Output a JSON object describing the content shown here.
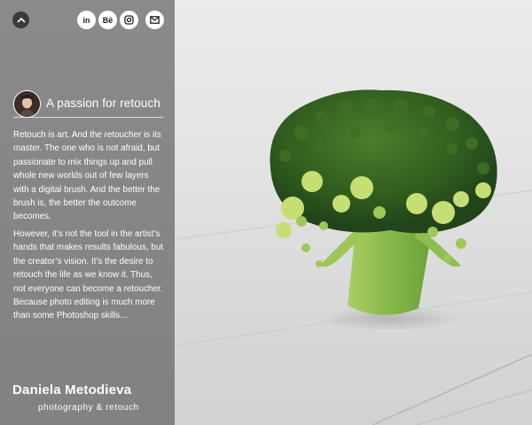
{
  "sidebar": {
    "headline": "A passion for retouch",
    "paragraphs": [
      "Retouch is art. And the retoucher is its master. The one who is not afraid, but passionate to mix things up and pull whole new worlds out of few layers with a digital brush. And the better the brush is, the better the outcome becomes.",
      "However, it’s not the tool in the artist’s hands that makes results fabulous, but the creator’s vision. It’s the desire to retouch the life as we know it. Thus, not everyone can become a retoucher. Because photo editing is much more than some Photoshop skills…"
    ],
    "brand_initial": "D",
    "brand_name": "aniela Metodieva",
    "tagline": "photography & retouch",
    "social": {
      "linkedin": "in",
      "behance": "Bē"
    }
  },
  "colors": {
    "sidebar_bg": "#5c5c5c",
    "broccoli_dark": "#2f5f1f",
    "broccoli_light": "#b9d86a"
  },
  "icons": [
    "chevron-up-icon",
    "linkedin-icon",
    "behance-icon",
    "instagram-icon",
    "mail-icon"
  ]
}
